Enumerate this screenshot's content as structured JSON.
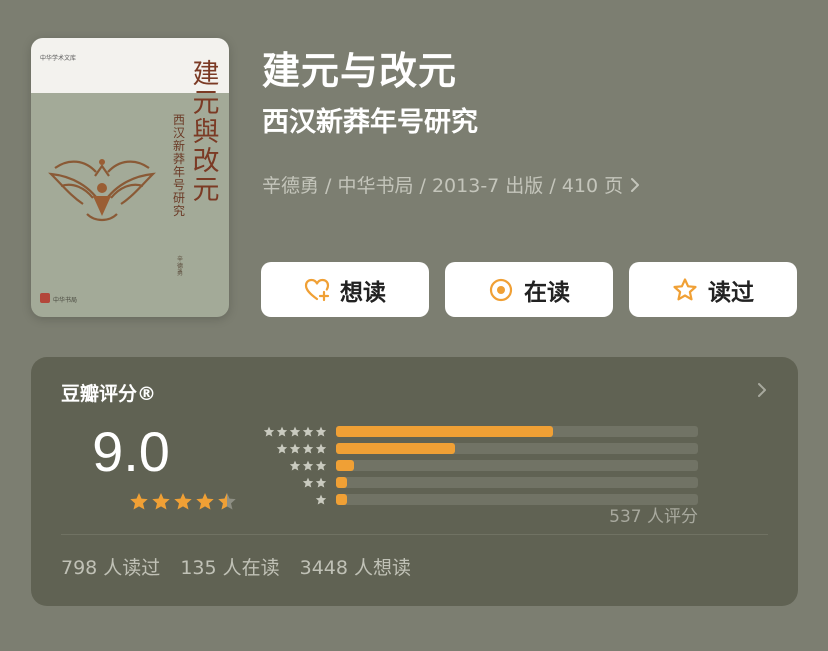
{
  "book": {
    "title": "建元与改元",
    "subtitle": "西汉新莽年号研究",
    "meta": "辛德勇 / 中华书局 / 2013-7 出版 / 410 页"
  },
  "cover": {
    "series": "中华学术文库",
    "title_chars": [
      "建",
      "元",
      "與",
      "改",
      "元"
    ],
    "subtitle_chars": [
      "西",
      "汉",
      "新",
      "莽",
      "年",
      "号",
      "研",
      "究"
    ],
    "author": "辛德勇",
    "publisher": "中华书局"
  },
  "actions": {
    "want": {
      "label": "想读",
      "icon": "heart-plus-icon"
    },
    "reading": {
      "label": "在读",
      "icon": "target-circle-icon"
    },
    "read": {
      "label": "读过",
      "icon": "star-outline-icon"
    }
  },
  "rating": {
    "title": "豆瓣评分®",
    "score": "9.0",
    "stars_value": 4.5,
    "distribution": [
      {
        "stars": 5,
        "fraction": 0.6
      },
      {
        "stars": 4,
        "fraction": 0.33
      },
      {
        "stars": 3,
        "fraction": 0.05
      },
      {
        "stars": 2,
        "fraction": 0.03
      },
      {
        "stars": 1,
        "fraction": 0.03
      }
    ],
    "count_label": "537 人评分"
  },
  "stats": {
    "read": "798 人读过",
    "reading": "135 人在读",
    "want": "3448 人想读"
  },
  "colors": {
    "background": "#7c7e71",
    "card": "#606253",
    "accent": "#f0a035",
    "track": "#717365"
  }
}
